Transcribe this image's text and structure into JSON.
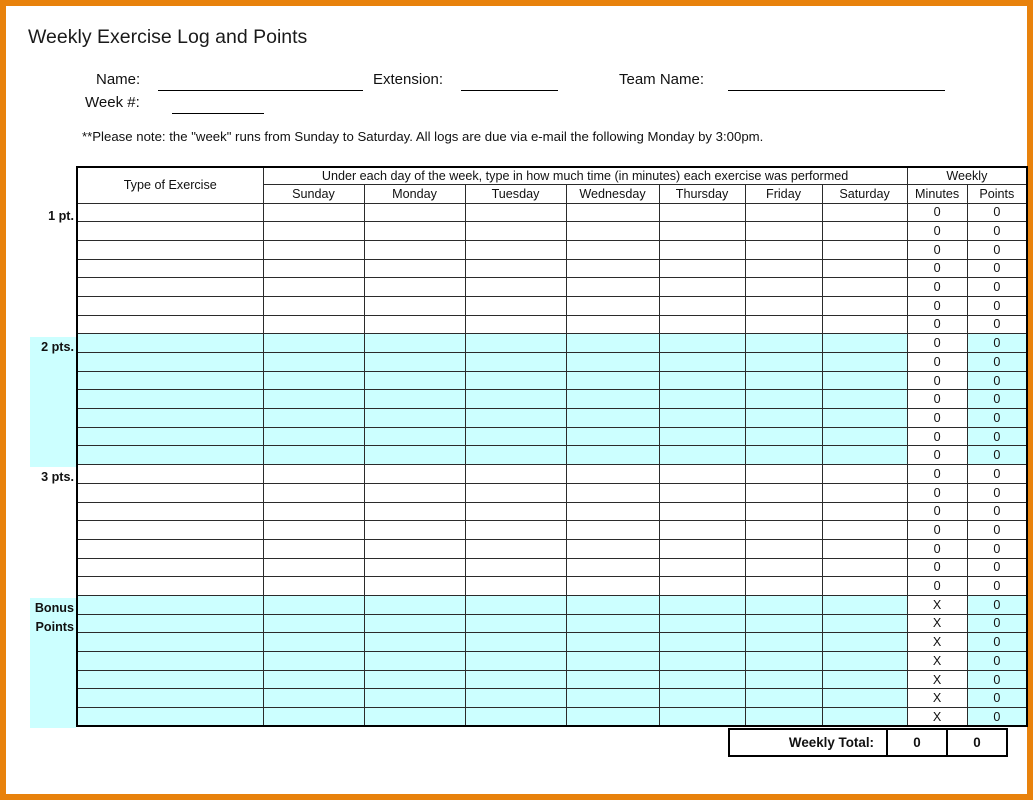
{
  "page": {
    "title": "Weekly Exercise Log and Points",
    "border_color": "#E8820C",
    "shade_color": "#CCFFFF"
  },
  "form": {
    "name_label": "Name:",
    "extension_label": "Extension:",
    "team_label": "Team Name:",
    "week_label": "Week #:",
    "name_value": "",
    "extension_value": "",
    "team_value": "",
    "week_value": "",
    "note": "**Please note: the \"week\" runs from Sunday to Saturday.  All logs are due via e-mail the following Monday by 3:00pm."
  },
  "table": {
    "exercise_header": "Type of Exercise",
    "days_header": "Under each day of the week, type in how much time (in minutes) each exercise was performed",
    "weekly_header": "Weekly",
    "days": [
      "Sunday",
      "Monday",
      "Tuesday",
      "Wednesday",
      "Thursday",
      "Friday",
      "Saturday"
    ],
    "weekly_columns": [
      "Minutes",
      "Points"
    ],
    "bands": [
      {
        "label": "1 pt.",
        "label_line1": "1 pt.",
        "label_line2": "",
        "shaded": false,
        "rows": 7,
        "minutes_value": "0",
        "points_value": "0",
        "points_shaded": false
      },
      {
        "label": "2 pts.",
        "label_line1": "2 pts.",
        "label_line2": "",
        "shaded": true,
        "rows": 7,
        "minutes_value": "0",
        "points_value": "0",
        "points_shaded": true
      },
      {
        "label": "3 pts.",
        "label_line1": "3 pts.",
        "label_line2": "",
        "shaded": false,
        "rows": 7,
        "minutes_value": "0",
        "points_value": "0",
        "points_shaded": false
      },
      {
        "label": "Bonus Points",
        "label_line1": "Bonus",
        "label_line2": "Points",
        "shaded": true,
        "rows": 7,
        "minutes_value": "X",
        "points_value": "0",
        "points_shaded": true
      }
    ]
  },
  "total": {
    "label": "Weekly Total:",
    "minutes": "0",
    "points": "0"
  }
}
